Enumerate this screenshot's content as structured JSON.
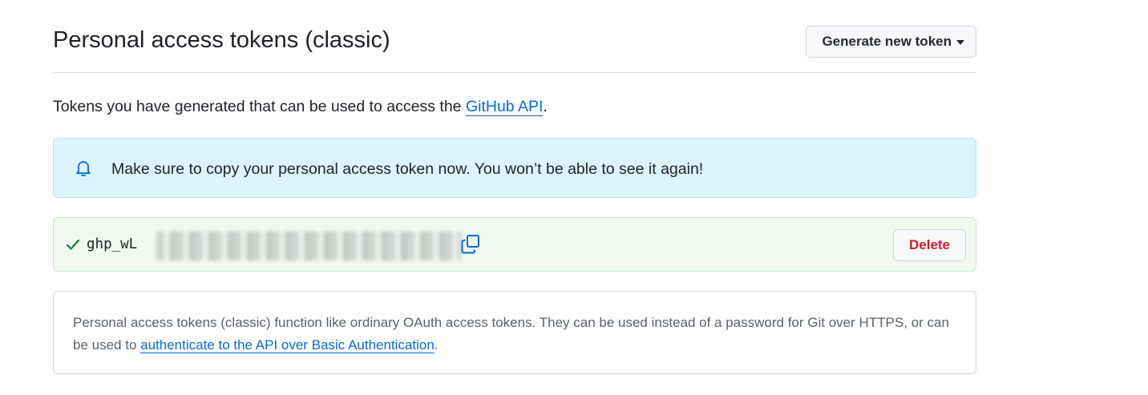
{
  "header": {
    "title": "Personal access tokens (classic)",
    "generate_button_label": "Generate new token"
  },
  "intro": {
    "text_before": "Tokens you have generated that can be used to access the ",
    "link_text": "GitHub API",
    "text_after": "."
  },
  "flash_notice": {
    "icon": "bell-icon",
    "message": "Make sure to copy your personal access token now. You won’t be able to see it again!"
  },
  "token_row": {
    "status_icon": "check-icon",
    "token_prefix": "ghp_wL",
    "copy_icon": "copy-icon",
    "delete_label": "Delete"
  },
  "info_box": {
    "text_before": "Personal access tokens (classic) function like ordinary OAuth access tokens. They can be used instead of a password for Git over HTTPS, or can be used to ",
    "link_text": "authenticate to the API over Basic Authentication",
    "text_after": "."
  },
  "colors": {
    "link": "#0969da",
    "info_bg": "#ddf4ff",
    "success_bg": "#f0f8ef",
    "success_icon": "#1a7f37",
    "danger": "#cf222e"
  }
}
